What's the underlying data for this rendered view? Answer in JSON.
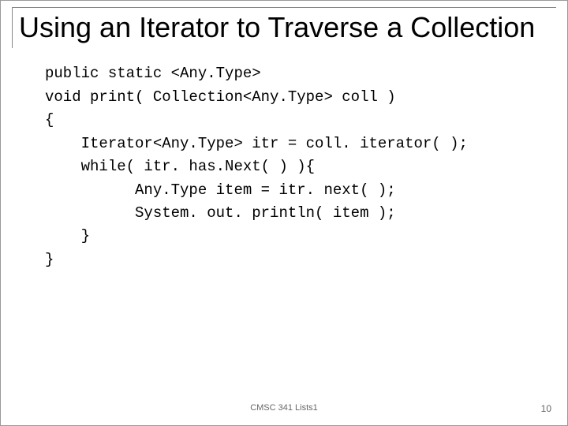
{
  "title": "Using an Iterator to Traverse a Collection",
  "code": {
    "l1": "public static <Any.Type>",
    "l2": "void print( Collection<Any.Type> coll )",
    "l3": "{",
    "l4": "    Iterator<Any.Type> itr = coll. iterator( );",
    "l5": "    while( itr. has.Next( ) ){",
    "l6": "          Any.Type item = itr. next( );",
    "l7": "          System. out. println( item );",
    "l8": "    }",
    "l9": "}"
  },
  "footer": "CMSC 341 Lists1",
  "page_number": "10"
}
